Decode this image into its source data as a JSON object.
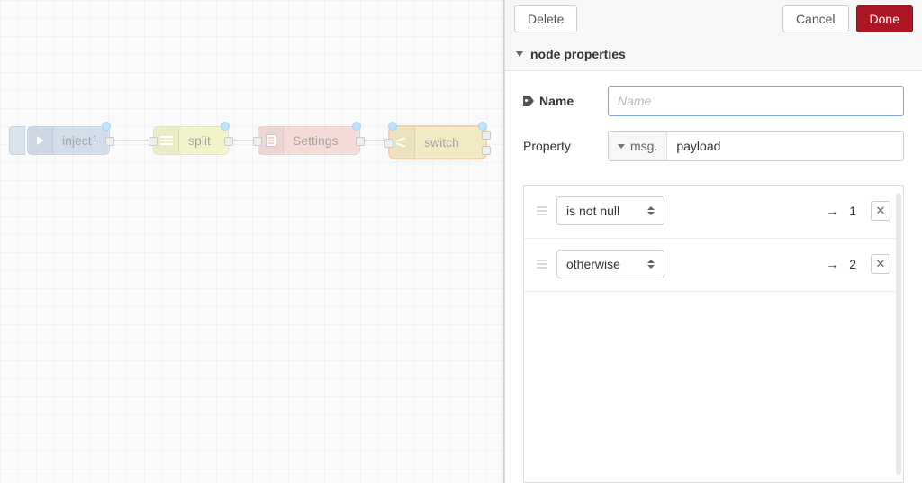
{
  "canvas": {
    "nodes": {
      "inject": {
        "label": "inject",
        "badge": "1"
      },
      "split": {
        "label": "split"
      },
      "settings": {
        "label": "Settings"
      },
      "switch": {
        "label": "switch"
      }
    }
  },
  "panel": {
    "buttons": {
      "delete": "Delete",
      "cancel": "Cancel",
      "done": "Done"
    },
    "section_title": "node properties",
    "name_label": "Name",
    "name_placeholder": "Name",
    "name_value": "",
    "property_label": "Property",
    "property_prefix": "msg.",
    "property_value": "payload",
    "rules": [
      {
        "op": "is not null",
        "output": "1"
      },
      {
        "op": "otherwise",
        "output": "2"
      }
    ],
    "arrow_glyph": "→"
  }
}
